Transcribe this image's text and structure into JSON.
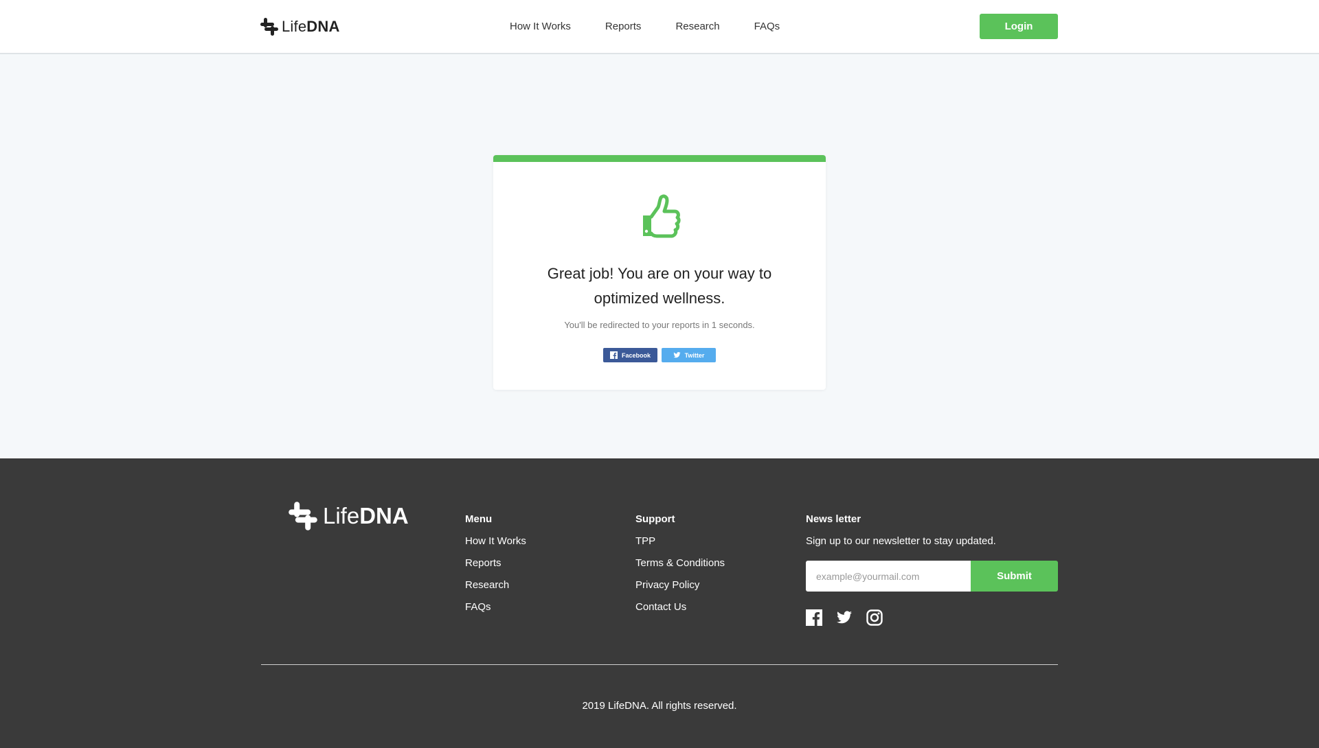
{
  "brand": {
    "name_light": "Life",
    "name_bold": "DNA"
  },
  "nav": {
    "items": [
      "How It Works",
      "Reports",
      "Research",
      "FAQs"
    ],
    "login_label": "Login"
  },
  "card": {
    "title": "Great job! You are on your way to optimized wellness.",
    "subtitle": "You'll be redirected to your reports in 1 seconds.",
    "share": {
      "facebook": "Facebook",
      "twitter": "Twitter"
    }
  },
  "footer": {
    "menu": {
      "heading": "Menu",
      "items": [
        "How It Works",
        "Reports",
        "Research",
        "FAQs"
      ]
    },
    "support": {
      "heading": "Support",
      "items": [
        "TPP",
        "Terms & Conditions",
        "Privacy Policy",
        "Contact Us"
      ]
    },
    "newsletter": {
      "heading": "News letter",
      "text": "Sign up to our newsletter to stay updated.",
      "placeholder": "example@yourmail.com",
      "submit_label": "Submit"
    },
    "socials": [
      "facebook-icon",
      "twitter-icon",
      "instagram-icon"
    ],
    "copyright": "2019 LifeDNA. All rights reserved."
  },
  "colors": {
    "accent": "#5bc25a",
    "footer_bg": "#3a3a3a",
    "page_bg": "#f5f8fa",
    "facebook": "#3b5998",
    "twitter": "#55acee"
  }
}
